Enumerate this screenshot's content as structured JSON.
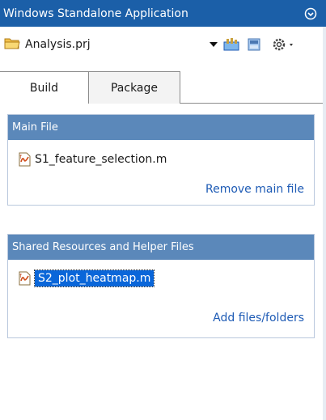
{
  "window": {
    "title": "Windows Standalone Application"
  },
  "project": {
    "selected": "Analysis.prj"
  },
  "toolbar": {
    "icons": [
      "folder-icon",
      "dropdown-arrow-icon",
      "toolbox-icon",
      "package-icon",
      "gear-icon"
    ]
  },
  "tabs": [
    {
      "label": "Build",
      "active": true
    },
    {
      "label": "Package",
      "active": false
    }
  ],
  "main_file": {
    "header": "Main File",
    "file": "S1_feature_selection.m",
    "action": "Remove main file"
  },
  "shared_files": {
    "header": "Shared Resources and Helper Files",
    "file": "S2_plot_heatmap.m",
    "action": "Add files/folders"
  },
  "colors": {
    "titlebar": "#1b5fa8",
    "section_header": "#5b88ba",
    "link": "#1e5bb5",
    "selection": "#0a66d9"
  }
}
